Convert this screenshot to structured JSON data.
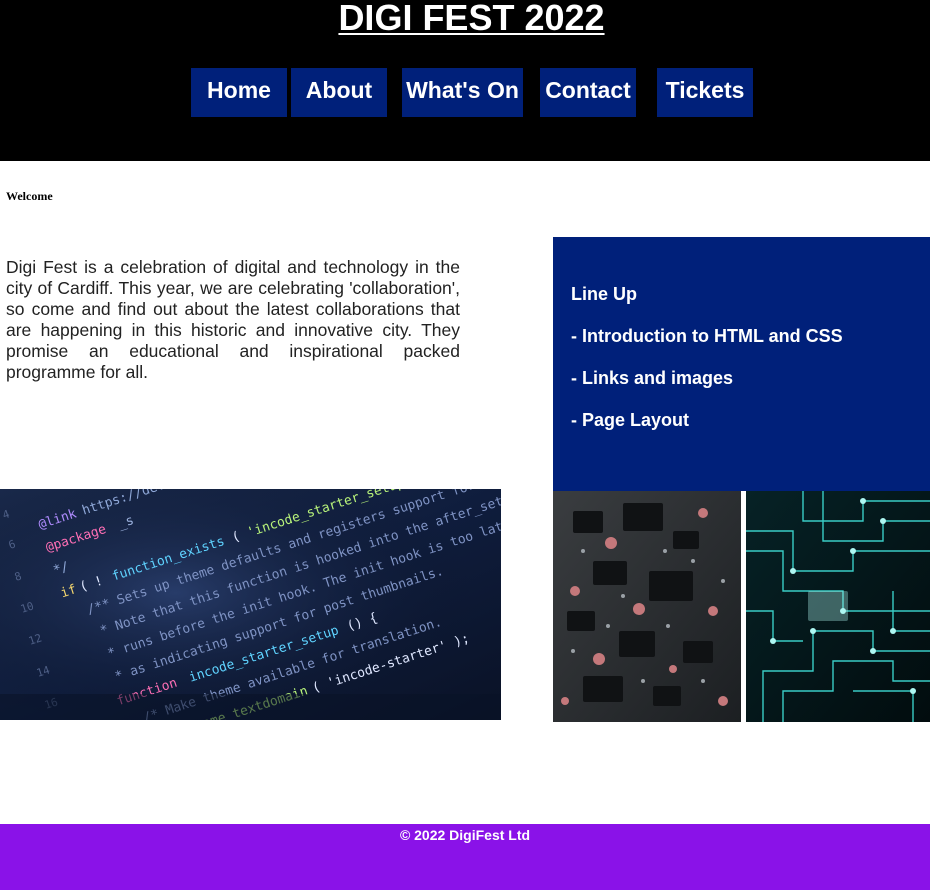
{
  "header": {
    "title": "DIGI FEST 2022",
    "background": "#000000"
  },
  "nav": {
    "items": [
      {
        "label": "Home"
      },
      {
        "label": "About"
      },
      {
        "label": "What's On"
      },
      {
        "label": "Contact"
      },
      {
        "label": "Tickets"
      }
    ],
    "button_color": "#00207a"
  },
  "main": {
    "welcome": "Welcome",
    "intro": "Digi Fest is a celebration of digital and technology in the city of Cardiff. This year, we are celebrating 'collaboration', so come and find out about the latest collaborations that are happening in this historic and innovative city. They promise an educational and inspirational packed programme for all."
  },
  "lineup": {
    "heading": "Line Up",
    "items": [
      "- Introduction to HTML and CSS",
      "- Links and images",
      "- Page Layout"
    ],
    "background": "#00207a"
  },
  "images": {
    "left": "code-editor-photo",
    "right": "circuit-board-photo"
  },
  "footer": {
    "text": "© 2022 DigiFest Ltd",
    "background": "#8a12e8"
  }
}
